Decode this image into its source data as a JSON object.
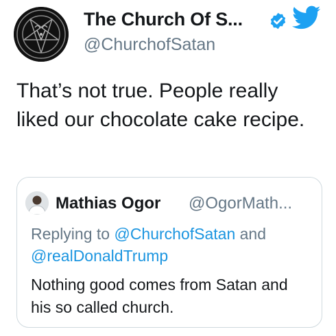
{
  "account": {
    "display_name": "The Church Of S...",
    "handle": "@ChurchofSatan",
    "verified": true,
    "avatar_icon": "sigil-of-baphomet-icon",
    "platform_icon": "twitter-bird-icon"
  },
  "tweet": {
    "text": "That’s not true. People really liked our chocolate cake recipe."
  },
  "quoted_tweet": {
    "display_name": "Mathias Ogor",
    "handle": "@OgorMath...",
    "replying_prefix": "Replying to",
    "replying_mention_1": "@ChurchofSatan",
    "replying_joiner": "and",
    "replying_mention_2": "@realDonaldTrump",
    "text": "Nothing good comes from Satan and his so called church."
  },
  "colors": {
    "text_primary": "#14171a",
    "text_secondary": "#657786",
    "mention_blue": "#1b95e0",
    "twitter_blue": "#1da1f2",
    "border": "#cfd9de"
  }
}
